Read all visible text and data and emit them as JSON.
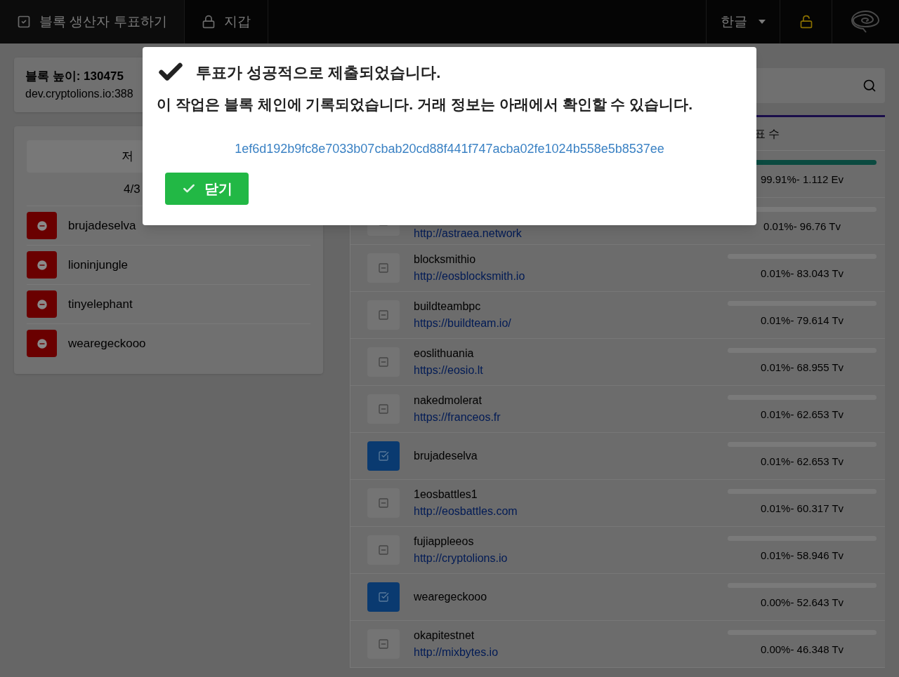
{
  "nav": {
    "items": [
      {
        "label": "블록 생산자 투표하기",
        "kind": "check"
      },
      {
        "label": "지갑",
        "kind": "lock"
      }
    ],
    "language": "한글"
  },
  "block_info": {
    "height": "블록 높이: 130475",
    "node": "dev.cryptolions.io:388"
  },
  "votes_panel": {
    "save_label": "저",
    "count": "4/3",
    "voted": [
      "brujadeselva",
      "lioninjungle",
      "tinyelephant",
      "wearegeckooo"
    ]
  },
  "producers": {
    "column_header": "표 수",
    "rows": [
      {
        "reading": "99.91%- 1.112 Ev",
        "level": 0.9991
      },
      {
        "checked": false,
        "url": "http://astraea.network",
        "reading": "0.01%- 96.76 Tv",
        "level": 0.0001
      },
      {
        "checked": false,
        "name": "blocksmithio",
        "url": "http://eosblocksmith.io",
        "reading": "0.01%- 83.043 Tv",
        "level": 0.0001
      },
      {
        "checked": false,
        "name": "buildteambpc",
        "url": "https://buildteam.io/",
        "reading": "0.01%- 79.614 Tv",
        "level": 0.0001
      },
      {
        "checked": false,
        "name": "eoslithuania",
        "url": "https://eosio.lt",
        "reading": "0.01%- 68.955 Tv",
        "level": 0.0001
      },
      {
        "checked": false,
        "name": "nakedmolerat",
        "url": "https://franceos.fr",
        "reading": "0.01%- 62.653 Tv",
        "level": 0.0001
      },
      {
        "checked": true,
        "name": "brujadeselva",
        "reading": "0.01%- 62.653 Tv",
        "level": 0.0001
      },
      {
        "checked": false,
        "name": "1eosbattles1",
        "url": "http://eosbattles.com",
        "reading": "0.01%- 60.317 Tv",
        "level": 0.0001
      },
      {
        "checked": false,
        "name": "fujiappleeos",
        "url": "http://cryptolions.io",
        "reading": "0.01%- 58.946 Tv",
        "level": 0.0001
      },
      {
        "checked": true,
        "name": "wearegeckooo",
        "reading": "0.00%- 52.643 Tv",
        "level": 0.0001
      },
      {
        "checked": false,
        "name": "okapitestnet",
        "url": "http://mixbytes.io",
        "reading": "0.00%- 46.348 Tv",
        "level": 0.0001
      }
    ]
  },
  "modal": {
    "title": "투표가 성공적으로 제출되었습니다.",
    "message": "이 작업은 블록 체인에 기록되었습니다. 거래 정보는 아래에서 확인할 수 있습니다.",
    "tx_id": "1ef6d192b9fc8e7033b07cbab20cd88f441f747acba02fe1024b558e5b8537ee",
    "close_label": "닫기"
  }
}
